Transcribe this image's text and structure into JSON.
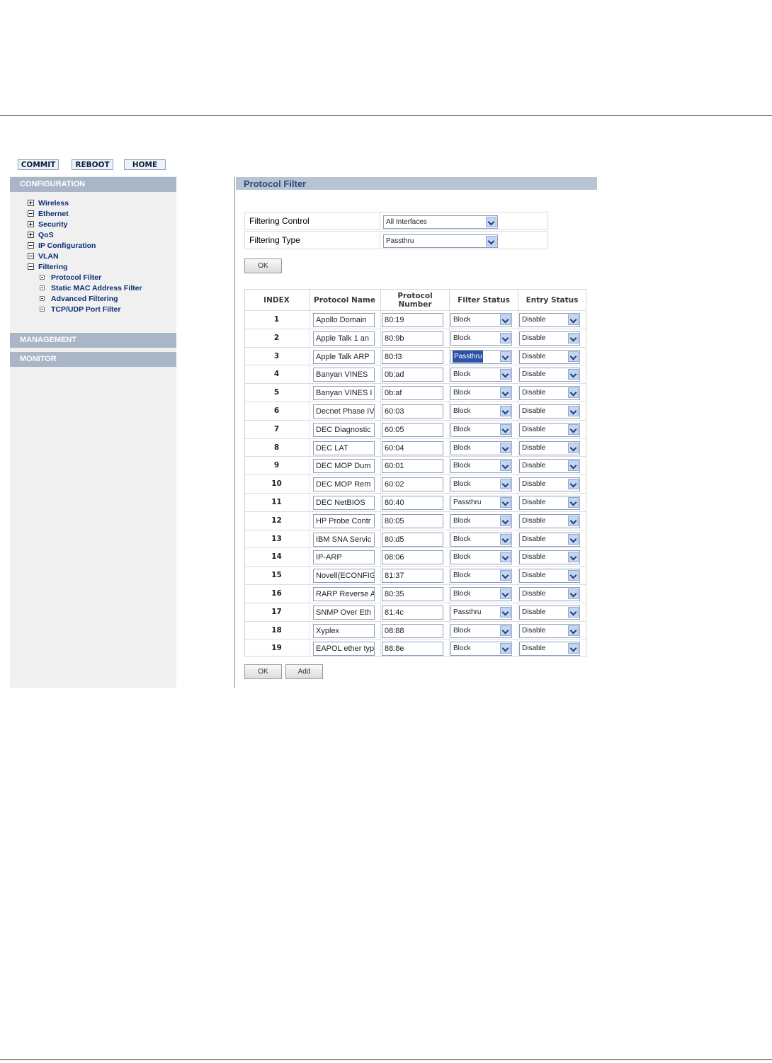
{
  "toolbar": {
    "commit": "COMMIT",
    "reboot": "REBOOT",
    "home": "HOME"
  },
  "sidebar": {
    "configuration": "CONFIGURATION",
    "management": "MANAGEMENT",
    "monitor": "MONITOR",
    "items": [
      {
        "label": "Wireless",
        "expanded": false
      },
      {
        "label": "Ethernet",
        "expanded": true
      },
      {
        "label": "Security",
        "expanded": false
      },
      {
        "label": "QoS",
        "expanded": false
      },
      {
        "label": "IP Configuration",
        "expanded": true
      },
      {
        "label": "VLAN",
        "expanded": true
      },
      {
        "label": "Filtering",
        "expanded": true
      }
    ],
    "subitems": [
      "Protocol Filter",
      "Static MAC Address Filter",
      "Advanced Filtering",
      "TCP/UDP Port Filter"
    ]
  },
  "main": {
    "title": "Protocol Filter",
    "filtering_control_label": "Filtering Control",
    "filtering_control_value": "All Interfaces",
    "filtering_type_label": "Filtering Type",
    "filtering_type_value": "Passthru",
    "ok_label": "OK",
    "add_label": "Add",
    "columns": [
      "INDEX",
      "Protocol Name",
      "Protocol Number",
      "Filter Status",
      "Entry Status"
    ],
    "rows": [
      {
        "index": "1",
        "name": "Apollo Domain",
        "number": "80:19",
        "filter": "Block",
        "entry": "Disable"
      },
      {
        "index": "2",
        "name": "Apple Talk 1 an",
        "number": "80:9b",
        "filter": "Block",
        "entry": "Disable"
      },
      {
        "index": "3",
        "name": "Apple Talk ARP",
        "number": "80:f3",
        "filter": "Passthru",
        "entry": "Disable",
        "highlight": true
      },
      {
        "index": "4",
        "name": "Banyan VINES",
        "number": "0b:ad",
        "filter": "Block",
        "entry": "Disable"
      },
      {
        "index": "5",
        "name": "Banyan VINES I",
        "number": "0b:af",
        "filter": "Block",
        "entry": "Disable"
      },
      {
        "index": "6",
        "name": "Decnet Phase IV",
        "number": "60:03",
        "filter": "Block",
        "entry": "Disable"
      },
      {
        "index": "7",
        "name": "DEC Diagnostic",
        "number": "60:05",
        "filter": "Block",
        "entry": "Disable"
      },
      {
        "index": "8",
        "name": "DEC LAT",
        "number": "60:04",
        "filter": "Block",
        "entry": "Disable"
      },
      {
        "index": "9",
        "name": "DEC MOP Dum",
        "number": "60:01",
        "filter": "Block",
        "entry": "Disable"
      },
      {
        "index": "10",
        "name": "DEC MOP Rem",
        "number": "60:02",
        "filter": "Block",
        "entry": "Disable"
      },
      {
        "index": "11",
        "name": "DEC NetBIOS",
        "number": "80:40",
        "filter": "Passthru",
        "entry": "Disable"
      },
      {
        "index": "12",
        "name": "HP Probe Contr",
        "number": "80:05",
        "filter": "Block",
        "entry": "Disable"
      },
      {
        "index": "13",
        "name": "IBM SNA Servic",
        "number": "80:d5",
        "filter": "Block",
        "entry": "Disable"
      },
      {
        "index": "14",
        "name": "IP-ARP",
        "number": "08:06",
        "filter": "Block",
        "entry": "Disable"
      },
      {
        "index": "15",
        "name": "Novell(ECONFIG",
        "number": "81:37",
        "filter": "Block",
        "entry": "Disable"
      },
      {
        "index": "16",
        "name": "RARP Reverse A",
        "number": "80:35",
        "filter": "Block",
        "entry": "Disable"
      },
      {
        "index": "17",
        "name": "SNMP Over Eth",
        "number": "81:4c",
        "filter": "Passthru",
        "entry": "Disable"
      },
      {
        "index": "18",
        "name": "Xyplex",
        "number": "08:88",
        "filter": "Block",
        "entry": "Disable"
      },
      {
        "index": "19",
        "name": "EAPOL ether typ",
        "number": "88:8e",
        "filter": "Block",
        "entry": "Disable"
      }
    ]
  }
}
